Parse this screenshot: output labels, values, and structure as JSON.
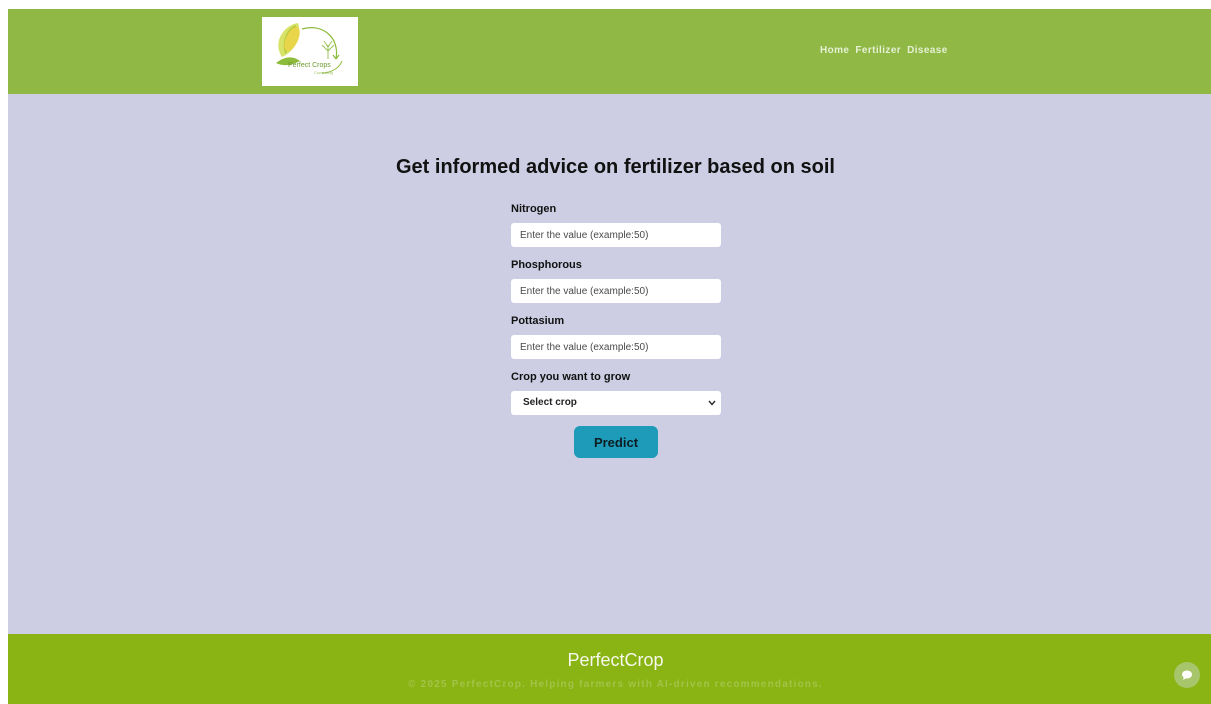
{
  "header": {
    "logo_text": "Perfect Crops",
    "logo_subtext": "Consulting",
    "nav": [
      {
        "label": "Home"
      },
      {
        "label": "Fertilizer"
      },
      {
        "label": "Disease"
      }
    ]
  },
  "main": {
    "title": "Get informed advice on fertilizer based on soil",
    "fields": [
      {
        "label": "Nitrogen",
        "placeholder": "Enter the value (example:50)",
        "value": ""
      },
      {
        "label": "Phosphorous",
        "placeholder": "Enter the value (example:50)",
        "value": ""
      },
      {
        "label": "Pottasium",
        "placeholder": "Enter the value (example:50)",
        "value": ""
      }
    ],
    "crop_select": {
      "label": "Crop you want to grow",
      "selected": "Select crop"
    },
    "predict_label": "Predict"
  },
  "footer": {
    "brand": "PerfectCrop",
    "copyright": "© 2025 PerfectCrop. Helping farmers with AI-driven recommendations."
  },
  "colors": {
    "header_bg": "#8fb845",
    "page_bg": "#cdcee3",
    "footer_bg": "#8ab314",
    "button_bg": "#1e9bb8"
  },
  "icons": {
    "logo": "corn-cob-logo",
    "select_caret": "chevron-down-icon",
    "chat": "chat-bubble-icon"
  }
}
